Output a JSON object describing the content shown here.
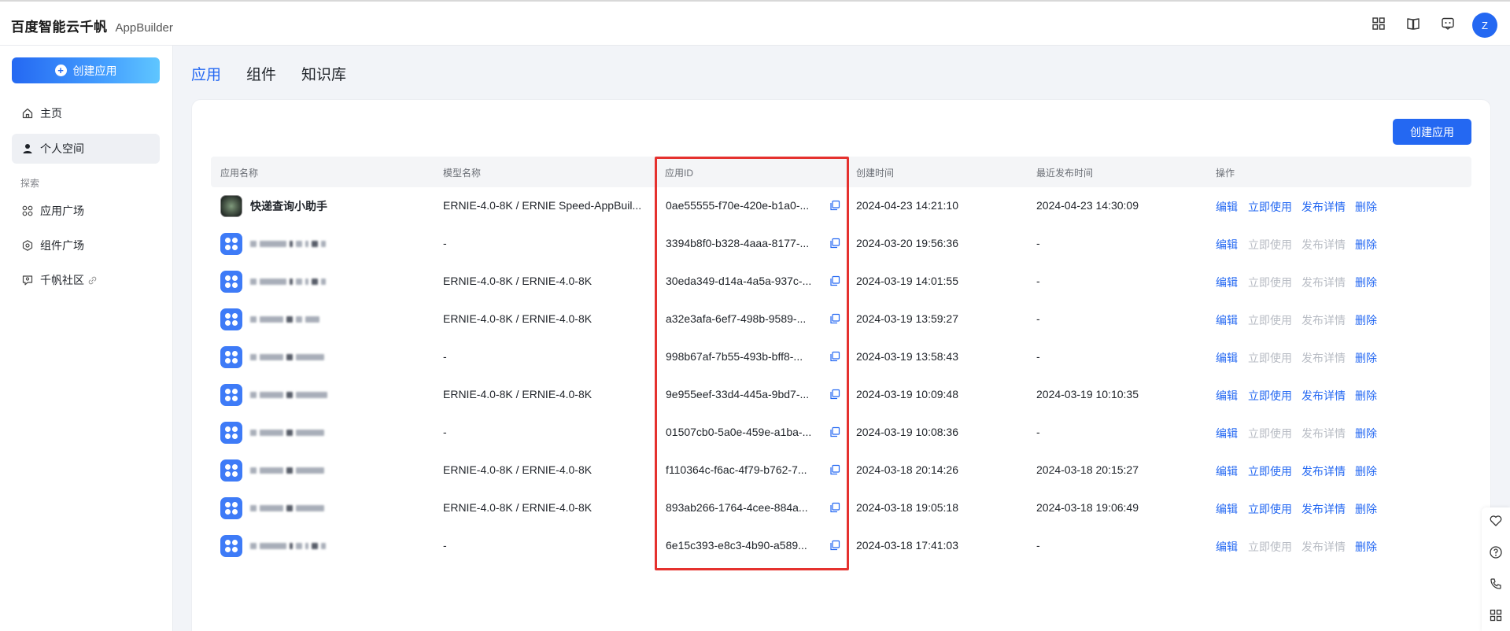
{
  "header": {
    "brand": "百度智能云千帆",
    "product": "AppBuilder",
    "avatar_initial": "Z",
    "icons": [
      "grid-icon",
      "book-icon",
      "message-icon"
    ]
  },
  "sidebar": {
    "create_label": "创建应用",
    "items": [
      {
        "label": "主页",
        "icon": "home-icon"
      },
      {
        "label": "个人空间",
        "icon": "user-icon"
      }
    ],
    "section_label": "探索",
    "explore_items": [
      {
        "label": "应用广场",
        "icon": "apps-icon"
      },
      {
        "label": "组件广场",
        "icon": "component-icon"
      },
      {
        "label": "千帆社区",
        "icon": "community-icon"
      }
    ]
  },
  "tabs": [
    {
      "label": "应用"
    },
    {
      "label": "组件"
    },
    {
      "label": "知识库"
    }
  ],
  "card": {
    "create_label": "创建应用"
  },
  "table": {
    "headers": [
      "应用名称",
      "模型名称",
      "应用ID",
      "创建时间",
      "最近发布时间",
      "操作"
    ],
    "op_labels": {
      "edit": "编辑",
      "use": "立即使用",
      "details": "发布详情",
      "delete": "删除"
    },
    "rows": [
      {
        "name": "快递查询小助手",
        "model": "ERNIE-4.0-8K / ERNIE Speed-AppBuil...",
        "id": "0ae55555-f70e-420e-b1a0-...",
        "created": "2024-04-23 14:21:10",
        "published": "2024-04-23 14:30:09",
        "ops_enabled": true
      },
      {
        "name": "",
        "model": "-",
        "id": "3394b8f0-b328-4aaa-8177-...",
        "created": "2024-03-20 19:56:36",
        "published": "-",
        "ops_enabled": false
      },
      {
        "name": "",
        "model": "ERNIE-4.0-8K / ERNIE-4.0-8K",
        "id": "30eda349-d14a-4a5a-937c-...",
        "created": "2024-03-19 14:01:55",
        "published": "-",
        "ops_enabled": false
      },
      {
        "name": "",
        "model": "ERNIE-4.0-8K / ERNIE-4.0-8K",
        "id": "a32e3afa-6ef7-498b-9589-...",
        "created": "2024-03-19 13:59:27",
        "published": "-",
        "ops_enabled": false
      },
      {
        "name": "",
        "model": "-",
        "id": "998b67af-7b55-493b-bff8-...",
        "created": "2024-03-19 13:58:43",
        "published": "-",
        "ops_enabled": false
      },
      {
        "name": "",
        "model": "ERNIE-4.0-8K / ERNIE-4.0-8K",
        "id": "9e955eef-33d4-445a-9bd7-...",
        "created": "2024-03-19 10:09:48",
        "published": "2024-03-19 10:10:35",
        "ops_enabled": true
      },
      {
        "name": "",
        "model": "-",
        "id": "01507cb0-5a0e-459e-a1ba-...",
        "created": "2024-03-19 10:08:36",
        "published": "-",
        "ops_enabled": false
      },
      {
        "name": "",
        "model": "ERNIE-4.0-8K / ERNIE-4.0-8K",
        "id": "f110364c-f6ac-4f79-b762-7...",
        "created": "2024-03-18 20:14:26",
        "published": "2024-03-18 20:15:27",
        "ops_enabled": true
      },
      {
        "name": "",
        "model": "ERNIE-4.0-8K / ERNIE-4.0-8K",
        "id": "893ab266-1764-4cee-884a...",
        "created": "2024-03-18 19:05:18",
        "published": "2024-03-18 19:06:49",
        "ops_enabled": true
      },
      {
        "name": "",
        "model": "-",
        "id": "6e15c393-e8c3-4b90-a589...",
        "created": "2024-03-18 17:41:03",
        "published": "-",
        "ops_enabled": false
      }
    ]
  },
  "side_rail": {
    "icons": [
      "heart-icon",
      "help-icon",
      "phone-icon",
      "apps-grid-icon"
    ]
  },
  "colors": {
    "accent": "#2468f2",
    "highlight_box": "#e5312e",
    "disabled_link": "#b8bcc4"
  }
}
